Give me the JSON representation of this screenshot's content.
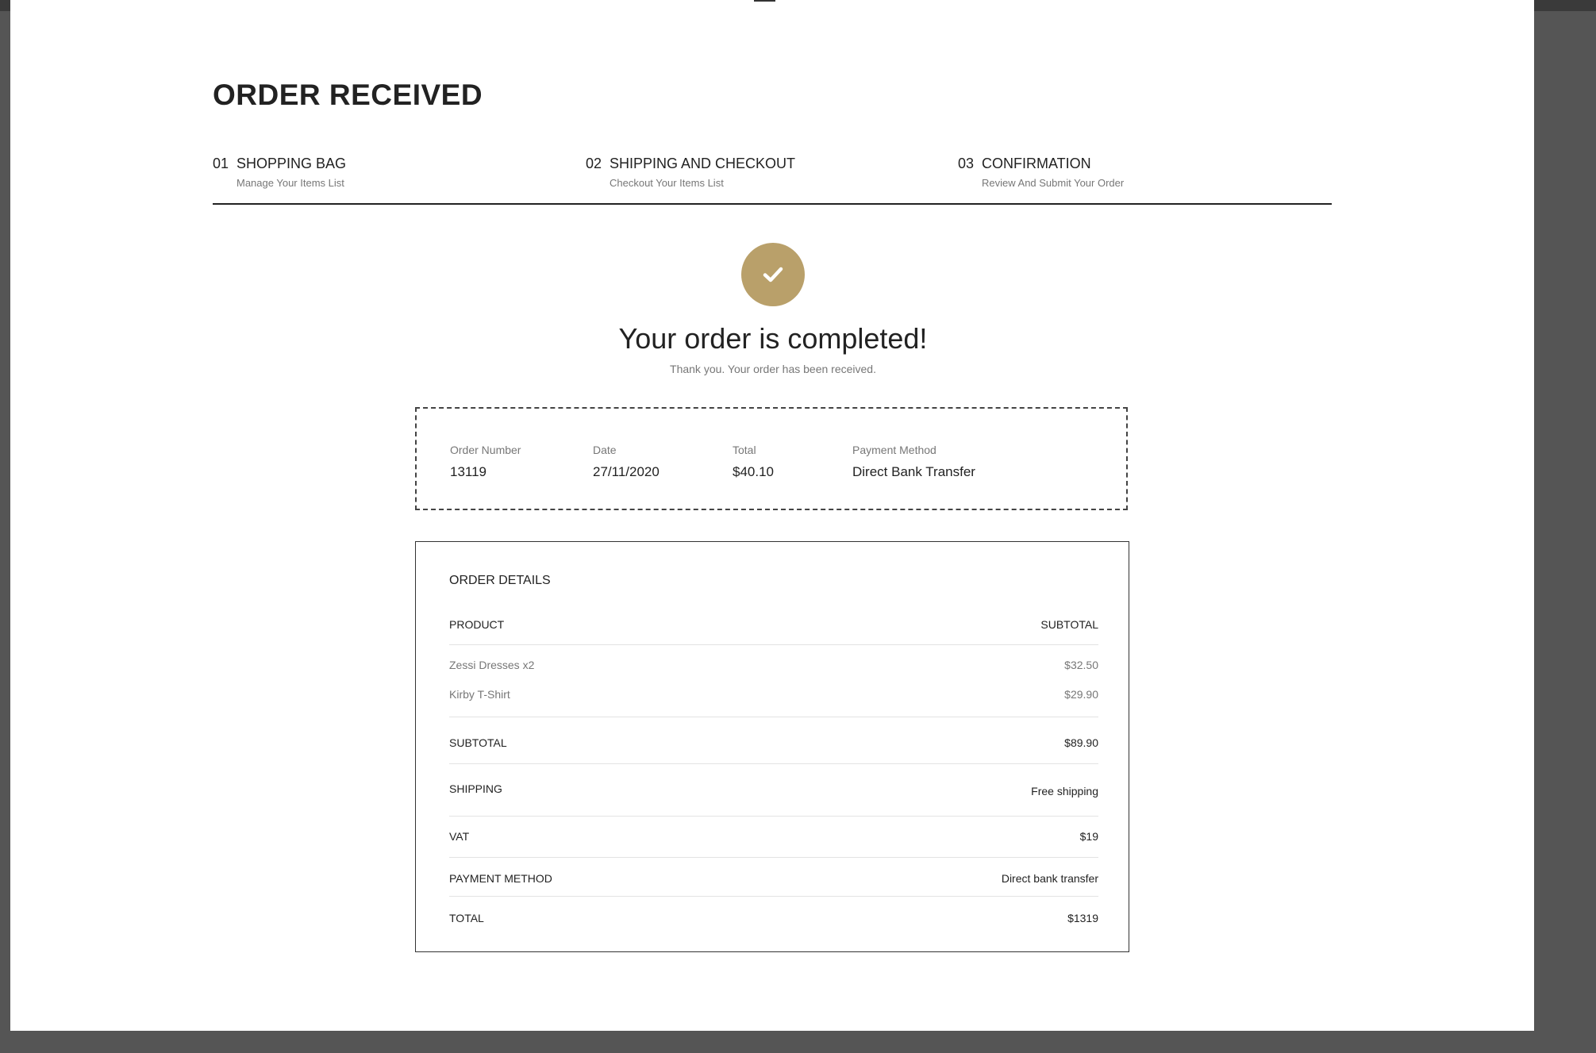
{
  "page": {
    "title": "ORDER RECEIVED"
  },
  "steps": [
    {
      "number": "01",
      "title": "SHOPPING BAG",
      "subtitle": "Manage Your Items List"
    },
    {
      "number": "02",
      "title": "SHIPPING AND CHECKOUT",
      "subtitle": "Checkout Your Items List"
    },
    {
      "number": "03",
      "title": "CONFIRMATION",
      "subtitle": "Review And Submit Your Order"
    }
  ],
  "confirmation": {
    "icon": "check-icon",
    "accent_color": "#b9a06a",
    "title": "Your order is completed!",
    "subtitle": "Thank you. Your order has been received."
  },
  "summary": {
    "order_number_label": "Order Number",
    "order_number": "13119",
    "date_label": "Date",
    "date": "27/11/2020",
    "total_label": "Total",
    "total": "$40.10",
    "payment_label": "Payment Method",
    "payment": "Direct Bank Transfer"
  },
  "details": {
    "title": "ORDER DETAILS",
    "product_header": "PRODUCT",
    "subtotal_header": "SUBTOTAL",
    "items": [
      {
        "name": "Zessi Dresses x2",
        "price": "$32.50"
      },
      {
        "name": "Kirby T-Shirt",
        "price": "$29.90"
      }
    ],
    "subtotal_label": "SUBTOTAL",
    "subtotal": "$89.90",
    "shipping_label": "SHIPPING",
    "shipping": "Free shipping",
    "vat_label": "VAT",
    "vat": "$19",
    "payment_method_label": "PAYMENT METHOD",
    "payment_method": "Direct bank transfer",
    "total_label": "TOTAL",
    "total": "$1319"
  }
}
